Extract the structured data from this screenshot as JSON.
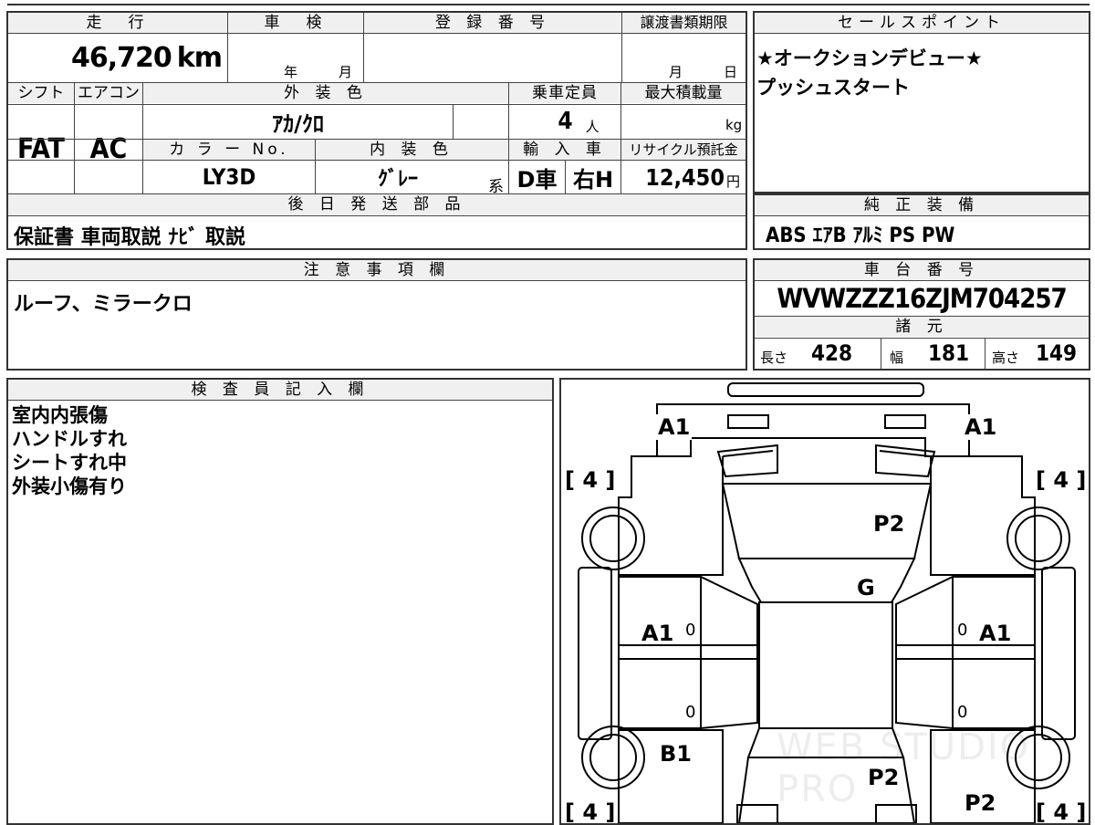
{
  "top": {
    "headers": {
      "mileage": "走　行",
      "inspection": "車　検",
      "registration": "登 録 番 号",
      "transfer_deadline": "譲渡書類期限",
      "shift": "シフト",
      "ac": "エアコン",
      "exterior": "外 装 色",
      "capacity": "乗車定員",
      "max_load": "最大積載量",
      "color_no": "カ ラ ー No.",
      "interior": "内 装 色",
      "import": "輸 入 車",
      "recycle": "リサイクル預託金",
      "later_parts": "後 日 発 送 部 品"
    },
    "mileage_value": "46,720",
    "mileage_unit": "km",
    "inspection_year": "年",
    "inspection_month": "月",
    "deadline_month": "月",
    "deadline_day": "日",
    "shift_value": "FAT",
    "ac_value": "AC",
    "exterior_value": "ｱｶ/ｸﾛ",
    "capacity_value": "4",
    "capacity_unit": "人",
    "max_load_unit": "kg",
    "color_no_value": "LY3D",
    "interior_value": "ｸﾞﾚｰ",
    "interior_suffix": "系",
    "import_drive": "D車",
    "import_handle": "右H",
    "recycle_value": "12,450",
    "recycle_unit": "円",
    "later_parts_value": "保証書 車両取説 ﾅﾋﾞ 取説"
  },
  "sales": {
    "header": "セールスポイント",
    "line1": "★オークションデビュー★",
    "line2": "プッシュスタート"
  },
  "equipment": {
    "header": "純 正 装 備",
    "value": "ABS ｴｱB ｱﾙﾐ PS PW"
  },
  "notes": {
    "header": "注 意 事 項 欄",
    "value": "ルーフ、ミラークロ"
  },
  "chassis": {
    "header": "車 台 番 号",
    "value": "WVWZZZ16ZJM704257"
  },
  "specs": {
    "header": "諸 元",
    "length_label": "長さ",
    "length_value": "428",
    "width_label": "幅",
    "width_value": "181",
    "height_label": "高さ",
    "height_value": "149"
  },
  "inspector": {
    "header": "検 査 員 記 入 欄",
    "lines": [
      "室内内張傷",
      "ハンドルすれ",
      "シートすれ中",
      "外装小傷有り"
    ]
  },
  "diagram": {
    "marks": {
      "front_left": "A1",
      "front_right": "A1",
      "hood": "P2",
      "windshield": "G",
      "left_front_door": "A1",
      "right_front_door": "A1",
      "left_rear_quarter": "B1",
      "trunk": "P2",
      "rear_right": "P2"
    },
    "door_zeros": [
      "0",
      "0",
      "0",
      "0"
    ],
    "tire_brackets": {
      "front_left": "[ 4 ]",
      "front_right": "[ 4 ]",
      "rear_left": "[ 4 ]",
      "rear_right": "[ 4 ]"
    },
    "watermark": "WEB STUDIO PRO"
  }
}
